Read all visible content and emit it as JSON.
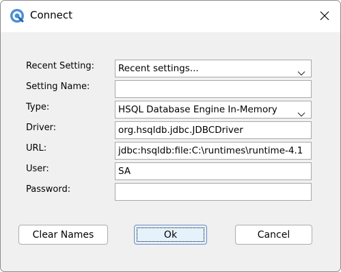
{
  "window": {
    "title": "Connect",
    "app_icon": "app-logo-icon",
    "close_icon": "close-icon"
  },
  "form": {
    "recent_setting": {
      "label": "Recent Setting:",
      "value": "Recent settings..."
    },
    "setting_name": {
      "label": "Setting Name:",
      "value": ""
    },
    "type": {
      "label": "Type:",
      "value": "HSQL Database Engine In-Memory"
    },
    "driver": {
      "label": "Driver:",
      "value": "org.hsqldb.jdbc.JDBCDriver"
    },
    "url": {
      "label": "URL:",
      "value": "jdbc:hsqldb:file:C:\\runtimes\\runtime-4.1"
    },
    "user": {
      "label": "User:",
      "value": "SA"
    },
    "password": {
      "label": "Password:",
      "value": ""
    }
  },
  "buttons": {
    "clear_names": "Clear Names",
    "ok": "Ok",
    "cancel": "Cancel"
  },
  "colors": {
    "dialog_background": "#f0f0f0",
    "titlebar": "#ffffff",
    "default_button": "#e5f1fb",
    "default_button_border": "#6a88c8",
    "field_border": "#a7a7a7"
  }
}
